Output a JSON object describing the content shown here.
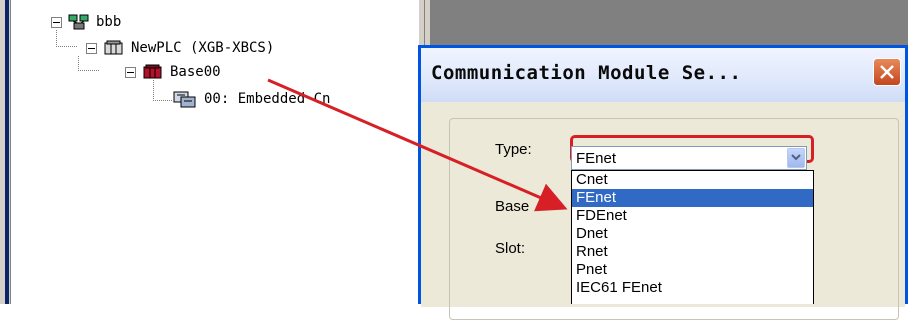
{
  "tree": {
    "root_label": "bbb",
    "plc_label": "NewPLC (XGB-XBCS)",
    "base_label": "Base00",
    "module_label": "00: Embedded Cn"
  },
  "dialog": {
    "title": "Communication Module Se...",
    "type_label": "Type:",
    "base_label": "Base",
    "slot_label": "Slot:",
    "type_value": "FEnet",
    "options": [
      "Cnet",
      "FEnet",
      "FDEnet",
      "Dnet",
      "Rnet",
      "Pnet",
      "IEC61 FEnet"
    ],
    "selected_option": "FEnet"
  },
  "colors": {
    "annotation_red": "#d71f26",
    "selection_blue": "#316ac5"
  },
  "icons": {
    "root": "network-icon",
    "plc": "plc-icon",
    "base": "base-rack-icon",
    "module": "communication-module-icon"
  }
}
